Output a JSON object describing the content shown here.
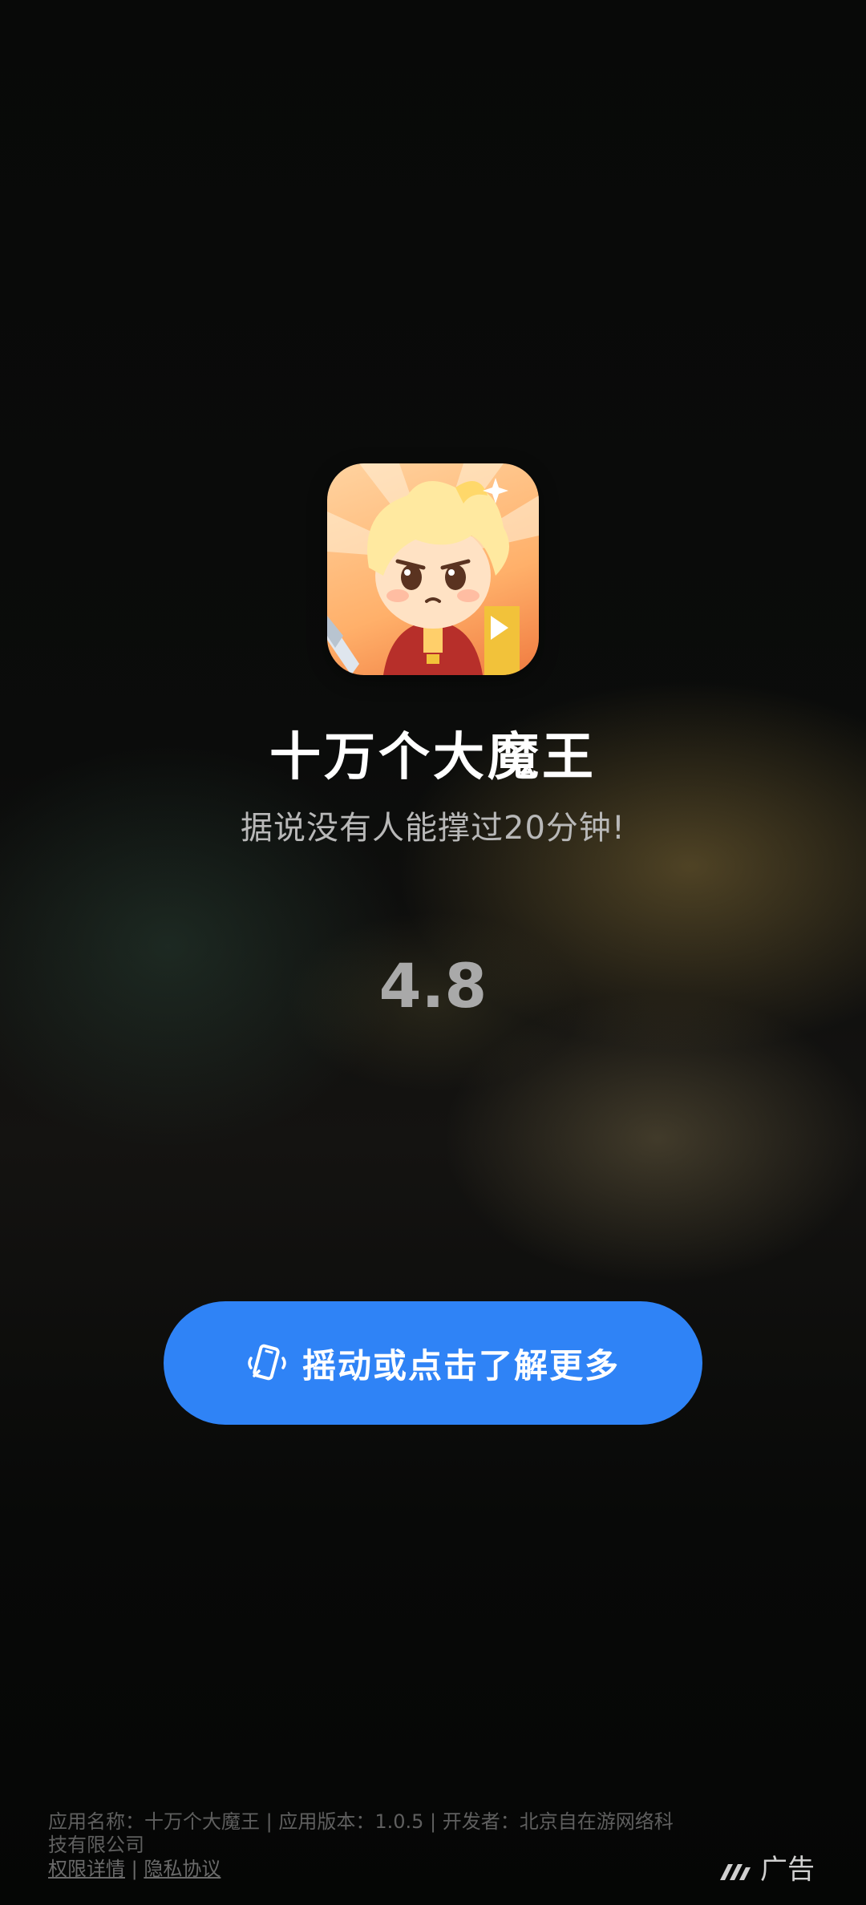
{
  "app": {
    "name": "十万个大魔王",
    "tagline": "据说没有人能撑过20分钟!",
    "rating": "4.8",
    "icon": "cartoon-hero-icon"
  },
  "cta": {
    "label": "摇动或点击了解更多",
    "icon": "shake-phone-icon",
    "color": "#2f83f6"
  },
  "footer": {
    "info": "应用名称：十万个大魔王 | 应用版本：1.0.5 | 开发者：北京自在游网络科技有限公司",
    "permissions_label": "权限详情",
    "separator": "|",
    "privacy_label": "隐私协议"
  },
  "ad": {
    "label": "广告",
    "icon": "ad-logo-icon"
  }
}
